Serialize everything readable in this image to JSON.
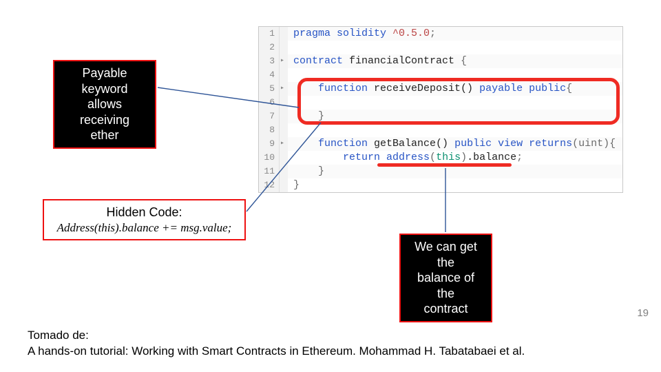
{
  "callouts": {
    "payable": {
      "line1": "Payable keyword",
      "line2": "allows receiving",
      "line3": "ether"
    },
    "hidden": {
      "line1": "Hidden Code:",
      "line2": "Address(this).balance += msg.value;"
    },
    "balance": {
      "line1": "We can get the",
      "line2": "balance of the",
      "line3": "contract"
    }
  },
  "code": {
    "fold3": "▸",
    "fold5": "▸",
    "fold9": "▸",
    "ln": [
      "1",
      "2",
      "3",
      "4",
      "5",
      "6",
      "7",
      "8",
      "9",
      "10",
      "11",
      "12"
    ],
    "l1_kw": "pragma solidity ",
    "l1_ver": "^0.5.0",
    "l1_semi": ";",
    "l3_kw": "contract ",
    "l3_id": "financialContract ",
    "l3_brace": "{",
    "l5_indent": "    ",
    "l5_fn": "function ",
    "l5_name": "receiveDeposit() ",
    "l5_mods": "payable public",
    "l5_brace": "{",
    "l7_indent": "    ",
    "l7_close": "}",
    "l9_indent": "    ",
    "l9_fn": "function ",
    "l9_name": "getBalance() ",
    "l9_mods": "public view returns",
    "l9_type": "(uint)",
    "l9_brace": "{",
    "l10_indent": "        ",
    "l10_ret": "return ",
    "l10_addr": "address",
    "l10_open": "(",
    "l10_this": "this",
    "l10_close": ")",
    "l10_bal": ".balance",
    "l10_semi": ";",
    "l11_indent": "    ",
    "l11_close": "}",
    "l12_close": "}"
  },
  "footer": {
    "tomado": "Tomado de:",
    "ref": "A hands-on tutorial: Working with Smart Contracts in Ethereum. Mohammad H. Tabatabaei et al."
  },
  "slide_number": "19"
}
